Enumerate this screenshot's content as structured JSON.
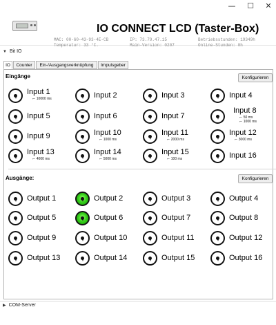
{
  "window": {
    "title": "IO CONNECT LCD (Taster-Box)",
    "min_icon": "minimize-icon",
    "max_icon": "maximize-icon",
    "close_icon": "close-icon",
    "min_glyph": "—",
    "max_glyph": "☐",
    "close_glyph": "✕"
  },
  "device": {
    "mac": "MAC: 00-60-43-93-4E-CB",
    "temperature": "Temperatur: 33 °C.",
    "ip": "IP: 73.79.47.15",
    "main_version": "Main-Version: 0207",
    "operating_hours": "Betriebsstunden: 19349h",
    "online_hours": "Online-Stunden: 0h"
  },
  "sections": {
    "bit_io": "Bit IO",
    "com_server": "COM-Server",
    "expanded_arrow": "▼",
    "collapsed_arrow": "▶"
  },
  "tabs": [
    {
      "label": "IO",
      "active": true
    },
    {
      "label": "Counter",
      "active": false
    },
    {
      "label": "Ein-/Ausgangsverknüpfung",
      "active": false
    },
    {
      "label": "Impulsgeber",
      "active": false
    }
  ],
  "inputs": {
    "title": "Eingänge",
    "configure": "Konfigurieren",
    "items": [
      {
        "label": "Input 1",
        "on": false,
        "timings": [
          {
            "sym": "⌐",
            "text": "10000 ms"
          }
        ]
      },
      {
        "label": "Input 2",
        "on": false,
        "timings": []
      },
      {
        "label": "Input 3",
        "on": false,
        "timings": []
      },
      {
        "label": "Input 4",
        "on": false,
        "timings": []
      },
      {
        "label": "Input 5",
        "on": false,
        "timings": []
      },
      {
        "label": "Input 6",
        "on": false,
        "timings": []
      },
      {
        "label": "Input 7",
        "on": false,
        "timings": []
      },
      {
        "label": "Input 8",
        "on": false,
        "timings": [
          {
            "sym": "⌐",
            "text": "50 ms"
          },
          {
            "sym": "⌐",
            "text": "1000 ms"
          }
        ]
      },
      {
        "label": "Input 9",
        "on": false,
        "timings": []
      },
      {
        "label": "Input 10",
        "on": false,
        "timings": [
          {
            "sym": "⌐",
            "text": "1000 ms"
          }
        ]
      },
      {
        "label": "Input 11",
        "on": false,
        "timings": [
          {
            "sym": "⌐",
            "text": "2000 ms"
          }
        ]
      },
      {
        "label": "Input 12",
        "on": false,
        "timings": [
          {
            "sym": "⌐",
            "text": "3000 ms"
          }
        ]
      },
      {
        "label": "Input 13",
        "on": false,
        "timings": [
          {
            "sym": "⌐",
            "text": "4000 ms"
          }
        ]
      },
      {
        "label": "Input 14",
        "on": false,
        "timings": [
          {
            "sym": "⌐",
            "text": "5000 ms"
          }
        ]
      },
      {
        "label": "Input 15",
        "on": false,
        "timings": [
          {
            "sym": "⌐",
            "text": "100 ms"
          }
        ]
      },
      {
        "label": "Input 16",
        "on": false,
        "timings": []
      }
    ]
  },
  "outputs": {
    "title": "Ausgänge:",
    "configure": "Konfigurieren",
    "items": [
      {
        "label": "Output 1",
        "on": false
      },
      {
        "label": "Output 2",
        "on": true
      },
      {
        "label": "Output 3",
        "on": false
      },
      {
        "label": "Output 4",
        "on": false
      },
      {
        "label": "Output 5",
        "on": false
      },
      {
        "label": "Output 6",
        "on": true
      },
      {
        "label": "Output 7",
        "on": false
      },
      {
        "label": "Output 8",
        "on": false
      },
      {
        "label": "Output 9",
        "on": false
      },
      {
        "label": "Output 10",
        "on": false
      },
      {
        "label": "Output 11",
        "on": false
      },
      {
        "label": "Output 12",
        "on": false
      },
      {
        "label": "Output 13",
        "on": false
      },
      {
        "label": "Output 14",
        "on": false
      },
      {
        "label": "Output 15",
        "on": false
      },
      {
        "label": "Output 16",
        "on": false
      }
    ]
  },
  "colors": {
    "led_on": "#37d11c",
    "led_off": "#ffffff"
  }
}
